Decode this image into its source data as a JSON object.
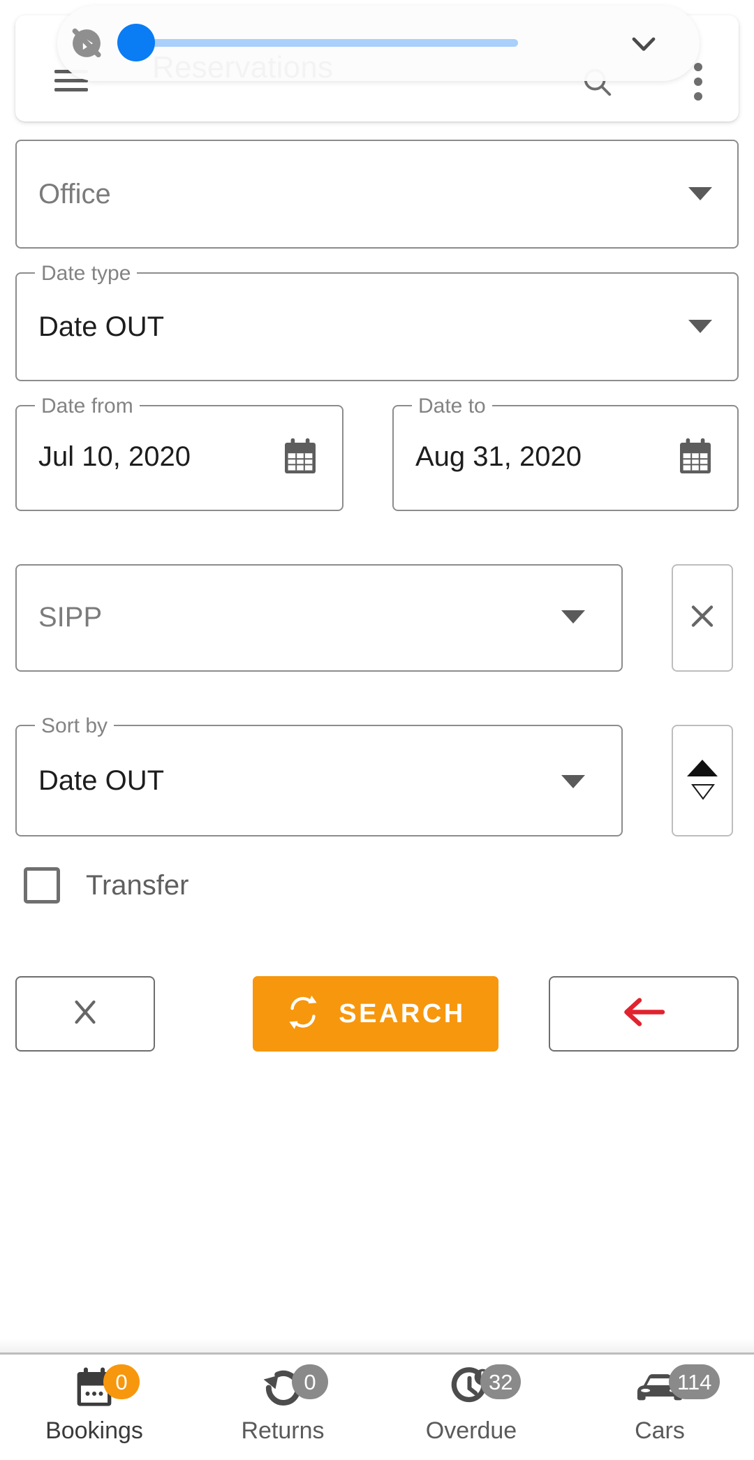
{
  "theme": {
    "accent_orange": "#f7970d",
    "slider_blue": "#0a7cf4",
    "slider_track_blue": "#a9cffa",
    "back_arrow_red": "#e0232e",
    "border_gray": "#8c8c8c",
    "badge_gray": "#8a8a8a"
  },
  "toolbar": {
    "title": "Reservations",
    "menu_icon": "hamburger-menu-icon",
    "search_icon": "search-icon",
    "overflow_icon": "overflow-menu-icon"
  },
  "volume_overlay": {
    "mute_icon": "ringer-muted-icon",
    "expand_icon": "chevron-down-icon",
    "slider_value_percent": 0
  },
  "form": {
    "office": {
      "value": "Office",
      "is_placeholder": true,
      "caret_icon": "caret-down-icon"
    },
    "date_type": {
      "label": "Date type",
      "value": "Date OUT",
      "caret_icon": "caret-down-icon"
    },
    "date_from": {
      "label": "Date from",
      "value": "Jul 10, 2020",
      "icon": "calendar-icon"
    },
    "date_to": {
      "label": "Date to",
      "value": "Aug 31, 2020",
      "icon": "calendar-icon"
    },
    "sipp": {
      "value": "SIPP",
      "is_placeholder": true,
      "caret_icon": "caret-down-icon",
      "clear_icon": "close-x-icon"
    },
    "sort_by": {
      "label": "Sort by",
      "value": "Date OUT",
      "caret_icon": "caret-down-icon",
      "direction": "ascending",
      "direction_icon": "sort-ascending-icon"
    },
    "transfer": {
      "label": "Transfer",
      "checked": false
    }
  },
  "actions": {
    "clear": {
      "icon": "close-x-icon"
    },
    "search": {
      "label": "SEARCH",
      "icon": "refresh-sync-icon"
    },
    "back": {
      "icon": "arrow-left-icon"
    }
  },
  "bottom_nav": {
    "items": [
      {
        "label": "Bookings",
        "badge": "0",
        "icon": "calendar-icon",
        "badge_accent": true,
        "active": true
      },
      {
        "label": "Returns",
        "badge": "0",
        "icon": "return-arrow-icon",
        "badge_accent": false,
        "active": false
      },
      {
        "label": "Overdue",
        "badge": "32",
        "icon": "clock-alert-icon",
        "badge_accent": false,
        "active": false
      },
      {
        "label": "Cars",
        "badge": "114",
        "icon": "car-icon",
        "badge_accent": false,
        "active": false
      }
    ]
  }
}
